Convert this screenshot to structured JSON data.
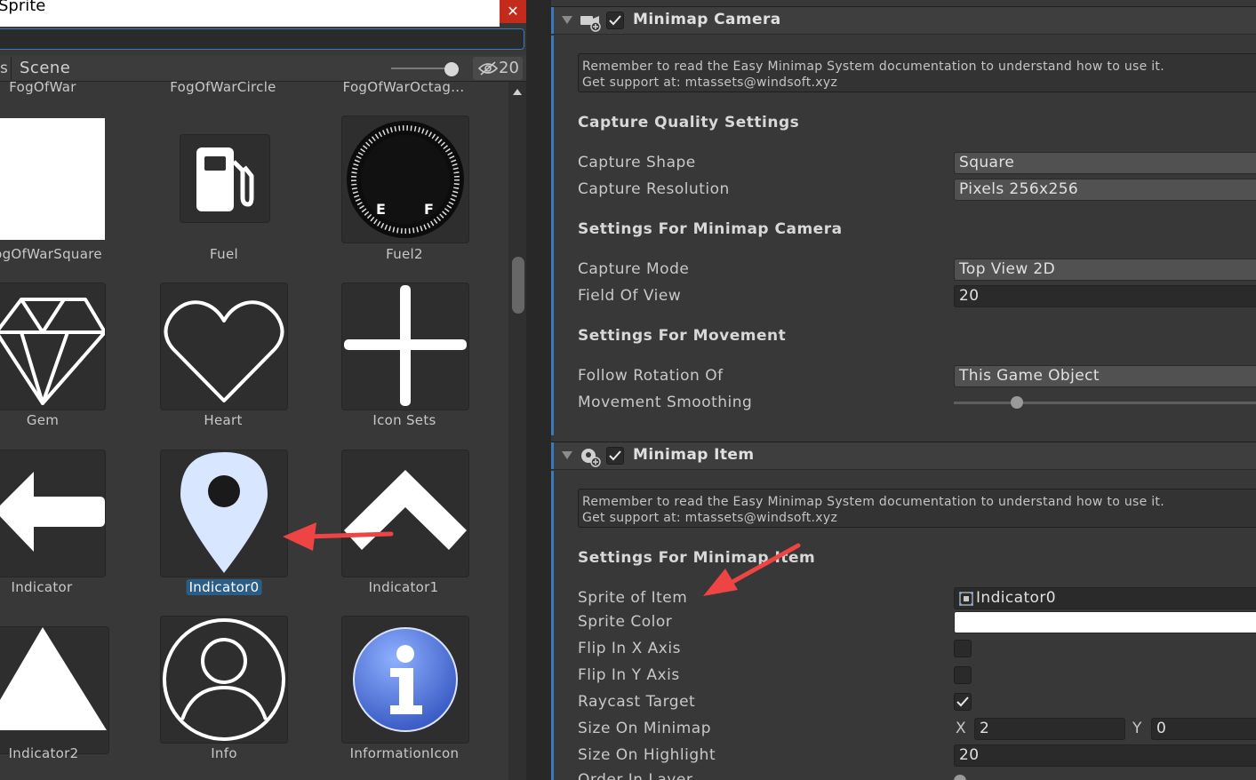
{
  "picker": {
    "title": "Sprite",
    "close_glyph": "✕",
    "search_value": "",
    "tabs": {
      "assets_partial": "s",
      "scene": "Scene"
    },
    "hidden_count": "20",
    "zoom_level": 0.9,
    "items": [
      {
        "label": "FogOfWar",
        "icon": "fog-of-war-sprite"
      },
      {
        "label": "FogOfWarCircle",
        "icon": "fog-of-war-circle-sprite"
      },
      {
        "label": "FogOfWarOctag...",
        "icon": "fog-of-war-octagon-sprite"
      },
      {
        "label": "ogOfWarSquare",
        "icon": "white-square-sprite"
      },
      {
        "label": "Fuel",
        "icon": "fuel-pump-icon"
      },
      {
        "label": "Fuel2",
        "icon": "fuel-gauge-icon"
      },
      {
        "label": "Gem",
        "icon": "gem-icon"
      },
      {
        "label": "Heart",
        "icon": "heart-icon"
      },
      {
        "label": "Icon Sets",
        "icon": "cross-icon"
      },
      {
        "label": "Indicator",
        "icon": "arrow-left-icon"
      },
      {
        "label": "Indicator0",
        "icon": "map-pin-icon",
        "selected": true
      },
      {
        "label": "Indicator1",
        "icon": "chevron-up-icon"
      },
      {
        "label": "Indicator2",
        "icon": "triangle-icon"
      },
      {
        "label": "Info",
        "icon": "user-circle-icon"
      },
      {
        "label": "InformationIcon",
        "icon": "information-icon"
      }
    ]
  },
  "inspector": {
    "camera_component": {
      "title": "Minimap Camera",
      "enabled": true,
      "help_line1": "Remember to read the Easy Minimap System documentation to understand how to use it.",
      "help_line2": "Get support at: mtassets@windsoft.xyz",
      "section_quality": "Capture Quality Settings",
      "capture_shape_label": "Capture Shape",
      "capture_shape_value": "Square",
      "capture_resolution_label": "Capture Resolution",
      "capture_resolution_value": "Pixels 256x256",
      "section_camera": "Settings For Minimap Camera",
      "capture_mode_label": "Capture Mode",
      "capture_mode_value": "Top View 2D",
      "fov_label": "Field Of View",
      "fov_value": "20",
      "section_movement": "Settings For Movement",
      "follow_rotation_label": "Follow Rotation Of",
      "follow_rotation_value": "This Game Object",
      "movement_smoothing_label": "Movement Smoothing",
      "movement_smoothing_fraction": 0.21
    },
    "item_component": {
      "title": "Minimap Item",
      "enabled": true,
      "help_line1": "Remember to read the Easy Minimap System documentation to understand how to use it.",
      "help_line2": "Get support at: mtassets@windsoft.xyz",
      "section_item": "Settings For Minimap Item",
      "sprite_label": "Sprite of Item",
      "sprite_value": "Indicator0",
      "sprite_color_label": "Sprite Color",
      "sprite_color_value": "#ffffff",
      "flip_x_label": "Flip In X Axis",
      "flip_x_value": false,
      "flip_y_label": "Flip In Y Axis",
      "flip_y_value": false,
      "raycast_label": "Raycast Target",
      "raycast_value": true,
      "size_label": "Size On Minimap",
      "size_x_label": "X",
      "size_x_value": "2",
      "size_y_label": "Y",
      "size_y_value": "0",
      "highlight_label": "Size On Highlight",
      "highlight_value": "20",
      "order_label_partial": "Order In Layer"
    }
  },
  "colors": {
    "accent": "#3a79bb",
    "annotation_arrow": "#ee4444",
    "selected_label": "#2c5d87",
    "pin": "#d8e6ff",
    "info_blue": "#4a6fd0"
  }
}
